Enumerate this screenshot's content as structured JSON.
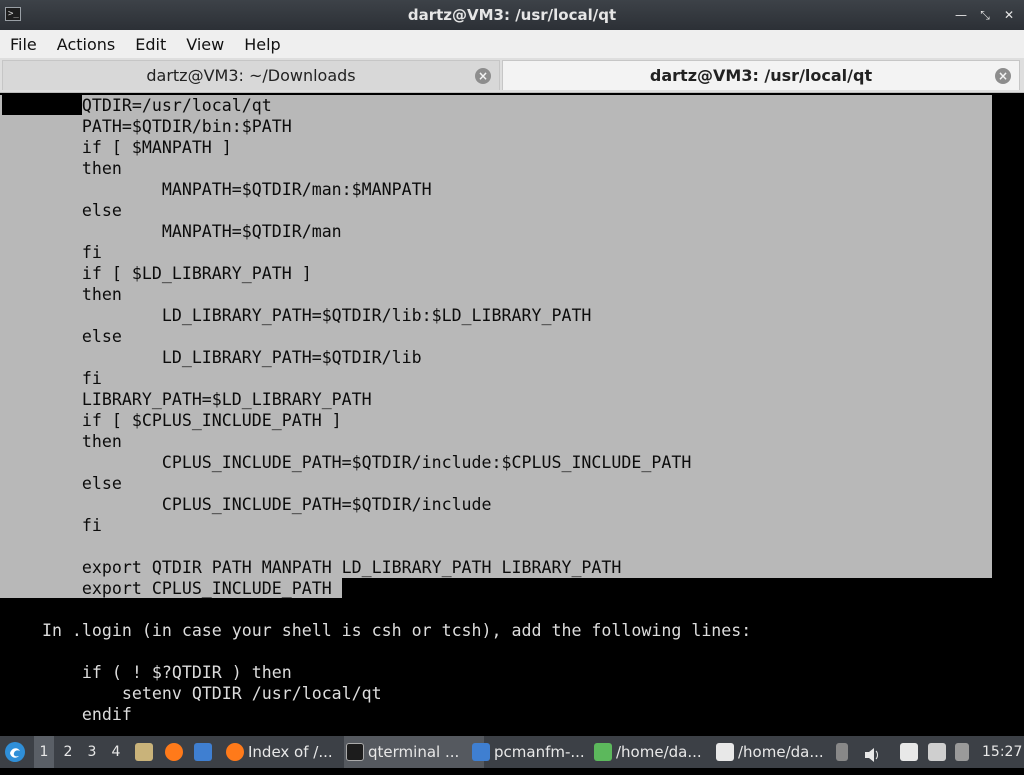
{
  "window": {
    "title": "dartz@VM3: /usr/local/qt",
    "app_icon_glyph": ">_",
    "minimize_glyph": "—",
    "maximize_glyph": "⤡",
    "close_glyph": "✕"
  },
  "menubar": {
    "items": [
      "File",
      "Actions",
      "Edit",
      "View",
      "Help"
    ]
  },
  "tabs": [
    {
      "label": "dartz@VM3: ~/Downloads",
      "active": false
    },
    {
      "label": "dartz@VM3: /usr/local/qt",
      "active": true
    }
  ],
  "tab_close_glyph": "×",
  "terminal": {
    "lines": [
      {
        "text": "        QTDIR=/usr/local/qt",
        "selected": true
      },
      {
        "text": "        PATH=$QTDIR/bin:$PATH",
        "selected": true
      },
      {
        "text": "        if [ $MANPATH ]",
        "selected": true
      },
      {
        "text": "        then",
        "selected": true
      },
      {
        "text": "                MANPATH=$QTDIR/man:$MANPATH",
        "selected": true
      },
      {
        "text": "        else",
        "selected": true
      },
      {
        "text": "                MANPATH=$QTDIR/man",
        "selected": true
      },
      {
        "text": "        fi",
        "selected": true
      },
      {
        "text": "        if [ $LD_LIBRARY_PATH ]",
        "selected": true
      },
      {
        "text": "        then",
        "selected": true
      },
      {
        "text": "                LD_LIBRARY_PATH=$QTDIR/lib:$LD_LIBRARY_PATH",
        "selected": true
      },
      {
        "text": "        else",
        "selected": true
      },
      {
        "text": "                LD_LIBRARY_PATH=$QTDIR/lib",
        "selected": true
      },
      {
        "text": "        fi",
        "selected": true
      },
      {
        "text": "        LIBRARY_PATH=$LD_LIBRARY_PATH",
        "selected": true
      },
      {
        "text": "        if [ $CPLUS_INCLUDE_PATH ]",
        "selected": true
      },
      {
        "text": "        then",
        "selected": true
      },
      {
        "text": "                CPLUS_INCLUDE_PATH=$QTDIR/include:$CPLUS_INCLUDE_PATH",
        "selected": true
      },
      {
        "text": "        else",
        "selected": true
      },
      {
        "text": "                CPLUS_INCLUDE_PATH=$QTDIR/include",
        "selected": true
      },
      {
        "text": "        fi",
        "selected": true
      },
      {
        "text": "",
        "selected": true
      },
      {
        "text": "        export QTDIR PATH MANPATH LD_LIBRARY_PATH LIBRARY_PATH",
        "selected": true
      },
      {
        "text": "        export CPLUS_INCLUDE_PATH",
        "selected": true
      },
      {
        "text": "",
        "selected": false
      },
      {
        "text": "    In .login (in case your shell is csh or tcsh), add the following lines:",
        "selected": false
      },
      {
        "text": "",
        "selected": false
      },
      {
        "text": "        if ( ! $?QTDIR ) then",
        "selected": false
      },
      {
        "text": "            setenv QTDIR /usr/local/qt",
        "selected": false
      },
      {
        "text": "        endif",
        "selected": false
      }
    ]
  },
  "taskbar": {
    "desktops": [
      "1",
      "2",
      "3",
      "4"
    ],
    "active_desktop": "1",
    "tasks": [
      {
        "label": "Index of /...",
        "icon": "firefox-icon"
      },
      {
        "label": "qterminal ...",
        "icon": "terminal-icon"
      },
      {
        "label": "pcmanfm-...",
        "icon": "folder-icon"
      },
      {
        "label": "/home/da...",
        "icon": "text-file-icon"
      },
      {
        "label": "/home/da...",
        "icon": "text-editor-icon"
      }
    ],
    "clock": "15:27"
  },
  "colors": {
    "selection": "#b8b8b8",
    "terminal_bg": "#000000",
    "terminal_fg": "#dddddd",
    "taskbar_bg": "#3c4046"
  }
}
